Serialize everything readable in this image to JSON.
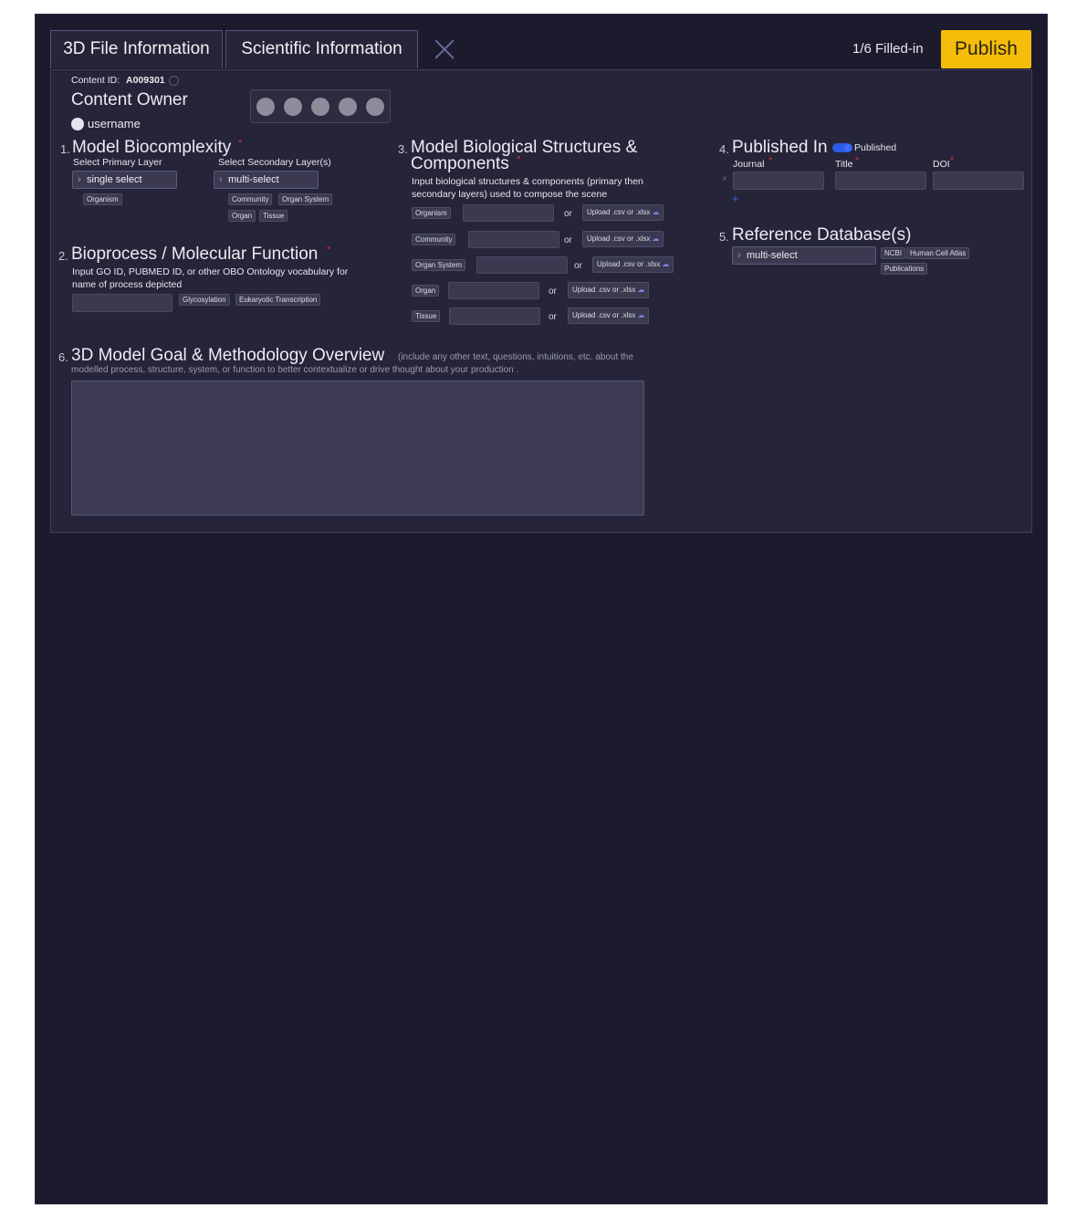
{
  "tabs": [
    {
      "label": "3D File Information"
    },
    {
      "label": "Scientific Information"
    }
  ],
  "header": {
    "filled_status": "1/6 Filled-in",
    "publish_label": "Publish"
  },
  "content": {
    "id_label": "Content ID:",
    "id_value": "A009301",
    "owner_title": "Content Owner",
    "username": "username"
  },
  "s1": {
    "num": "1.",
    "title": "Model Biocomplexity",
    "required": "*",
    "primary_label": "Select Primary Layer",
    "primary_select": "single select",
    "primary_chips": [
      "Organism"
    ],
    "secondary_label": "Select Secondary Layer(s)",
    "secondary_select": "multi-select",
    "secondary_chips": [
      "Community",
      "Organ System",
      "Organ",
      "Tissue"
    ]
  },
  "s2": {
    "num": "2.",
    "title": "Bioprocess / Molecular Function",
    "required": "*",
    "desc1": "Input GO ID, PUBMED ID, or other OBO Ontology vocabulary for",
    "desc2": "name of process depicted",
    "chips": [
      "Glycosylation",
      "Eukaryotic Transcription"
    ]
  },
  "s3": {
    "num": "3.",
    "title1": "Model Biological Structures &",
    "title2": "Components",
    "required": "*",
    "desc1": "Input biological structures & components (primary then",
    "desc2": "secondary layers) used to compose the scene",
    "or_label": "or",
    "upload_label": "Upload .csv or .xlsx",
    "rows": [
      {
        "label": "Organism"
      },
      {
        "label": "Community"
      },
      {
        "label": "Organ System"
      },
      {
        "label": "Organ"
      },
      {
        "label": "Tissue"
      }
    ]
  },
  "s4": {
    "num": "4.",
    "title": "Published In",
    "toggle_label": "Published",
    "journal_label": "Journal",
    "title_label": "Title",
    "doi_label": "DOI",
    "required": "*",
    "remove_symbol": "×",
    "add_symbol": "+"
  },
  "s5": {
    "num": "5.",
    "title": "Reference Database(s)",
    "select": "multi-select",
    "chips": [
      "NCBI",
      "Human Cell Atlas",
      "Publications"
    ]
  },
  "s6": {
    "num": "6.",
    "title": "3D Model Goal & Methodology Overview",
    "note1": "(include any other text, questions, intuitions, etc. about the",
    "note2": "modelled process, structure, system, or  function to better contextualize or drive thought about your production ."
  },
  "colors": {
    "background": "#1c1b2e",
    "panel": "#252438",
    "field": "#3a3950",
    "accent": "#f5bd0a",
    "toggle": "#2b5be6",
    "required": "#d0303a",
    "add": "#3b5bf0"
  }
}
